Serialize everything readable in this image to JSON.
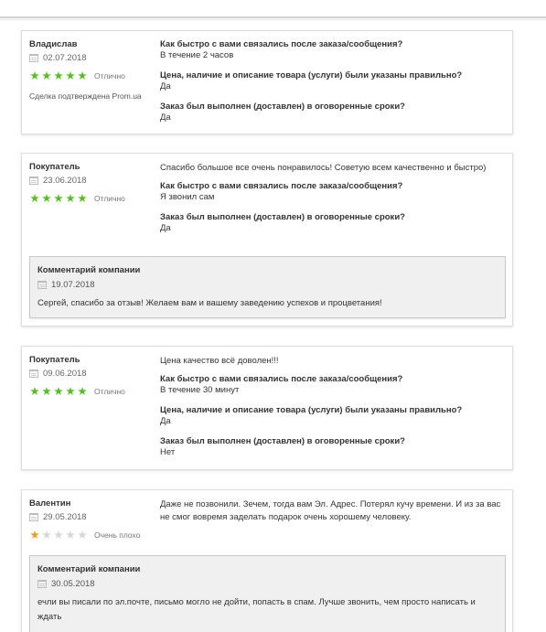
{
  "reviews": [
    {
      "author": "Владислав",
      "date": "02.07.2018",
      "stars": 5,
      "rating_label": "Отлично",
      "verified": "Сделка подтверждена Prom.ua",
      "qa": [
        {
          "q": "Как быстро с вами связались после заказа/сообщения?",
          "a": "В течение 2 часов"
        },
        {
          "q": "Цена, наличие и описание товара (услуги) были указаны правильно?",
          "a": "Да"
        },
        {
          "q": "Заказ был выполнен (доставлен) в оговоренные сроки?",
          "a": "Да"
        }
      ]
    },
    {
      "author": "Покупатель",
      "date": "23.06.2018",
      "stars": 5,
      "rating_label": "Отлично",
      "text": "Спасибо большое все очень понравилось! Советую всем качественно и быстро)",
      "qa": [
        {
          "q": "Как быстро с вами связались после заказа/сообщения?",
          "a": "Я звонил сам"
        },
        {
          "q": "Заказ был выполнен (доставлен) в оговоренные сроки?",
          "a": "Да"
        }
      ],
      "company_comment": {
        "title": "Комментарий компании",
        "date": "19.07.2018",
        "text": "Сергей, спасибо за отзыв! Желаем вам и вашему заведению успехов и процветания!"
      }
    },
    {
      "author": "Покупатель",
      "date": "09.06.2018",
      "stars": 5,
      "rating_label": "Отлично",
      "text": "Цена качество всё доволен!!!",
      "qa": [
        {
          "q": "Как быстро с вами связались после заказа/сообщения?",
          "a": "В течение 30 минут"
        },
        {
          "q": "Цена, наличие и описание товара (услуги) были указаны правильно?",
          "a": "Да"
        },
        {
          "q": "Заказ был выполнен (доставлен) в оговоренные сроки?",
          "a": "Нет"
        }
      ]
    },
    {
      "author": "Валентин",
      "date": "29.05.2018",
      "stars": 1,
      "rating_label": "Очень плохо",
      "text": "Даже не позвонили. Зечем, тогда вам Эл. Адрес. Потерял кучу времени. И из за вас не смог вовремя заделать подарок очень хорошему человеку.",
      "company_comment": {
        "title": "Комментарий компании",
        "date": "30.05.2018",
        "text": "ечли вы писали по эл.почте, письмо могло не дойти, попасть в спам. Лучше звонить, чем просто написать и ждать"
      }
    }
  ],
  "colors": {
    "star_on": "#55c020",
    "star_low": "#f09a28",
    "star_off": "#d7d7d7"
  },
  "icons": {
    "star": "★",
    "calendar": "calendar-icon"
  }
}
